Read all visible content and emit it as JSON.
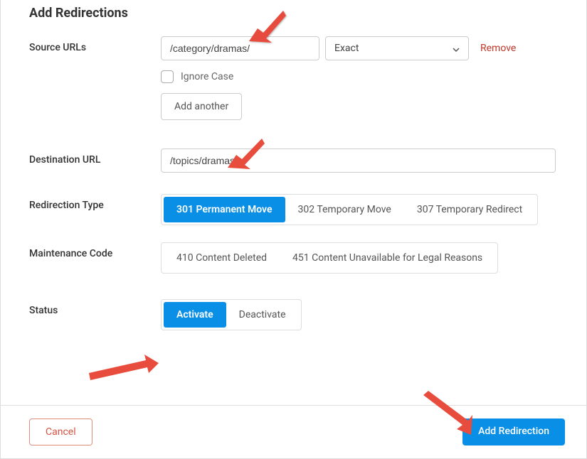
{
  "title": "Add Redirections",
  "sourceUrls": {
    "label": "Source URLs",
    "value": "/category/dramas/",
    "matchType": "Exact",
    "removeLabel": "Remove",
    "ignoreCaseLabel": "Ignore Case",
    "addAnotherLabel": "Add another"
  },
  "destination": {
    "label": "Destination URL",
    "value": "/topics/dramas/"
  },
  "redirectionType": {
    "label": "Redirection Type",
    "options": [
      {
        "label": "301 Permanent Move",
        "active": true
      },
      {
        "label": "302 Temporary Move",
        "active": false
      },
      {
        "label": "307 Temporary Redirect",
        "active": false
      }
    ]
  },
  "maintenanceCode": {
    "label": "Maintenance Code",
    "options": [
      {
        "label": "410 Content Deleted",
        "active": false
      },
      {
        "label": "451 Content Unavailable for Legal Reasons",
        "active": false
      }
    ]
  },
  "status": {
    "label": "Status",
    "options": [
      {
        "label": "Activate",
        "active": true
      },
      {
        "label": "Deactivate",
        "active": false
      }
    ]
  },
  "footer": {
    "cancelLabel": "Cancel",
    "submitLabel": "Add Redirection"
  }
}
